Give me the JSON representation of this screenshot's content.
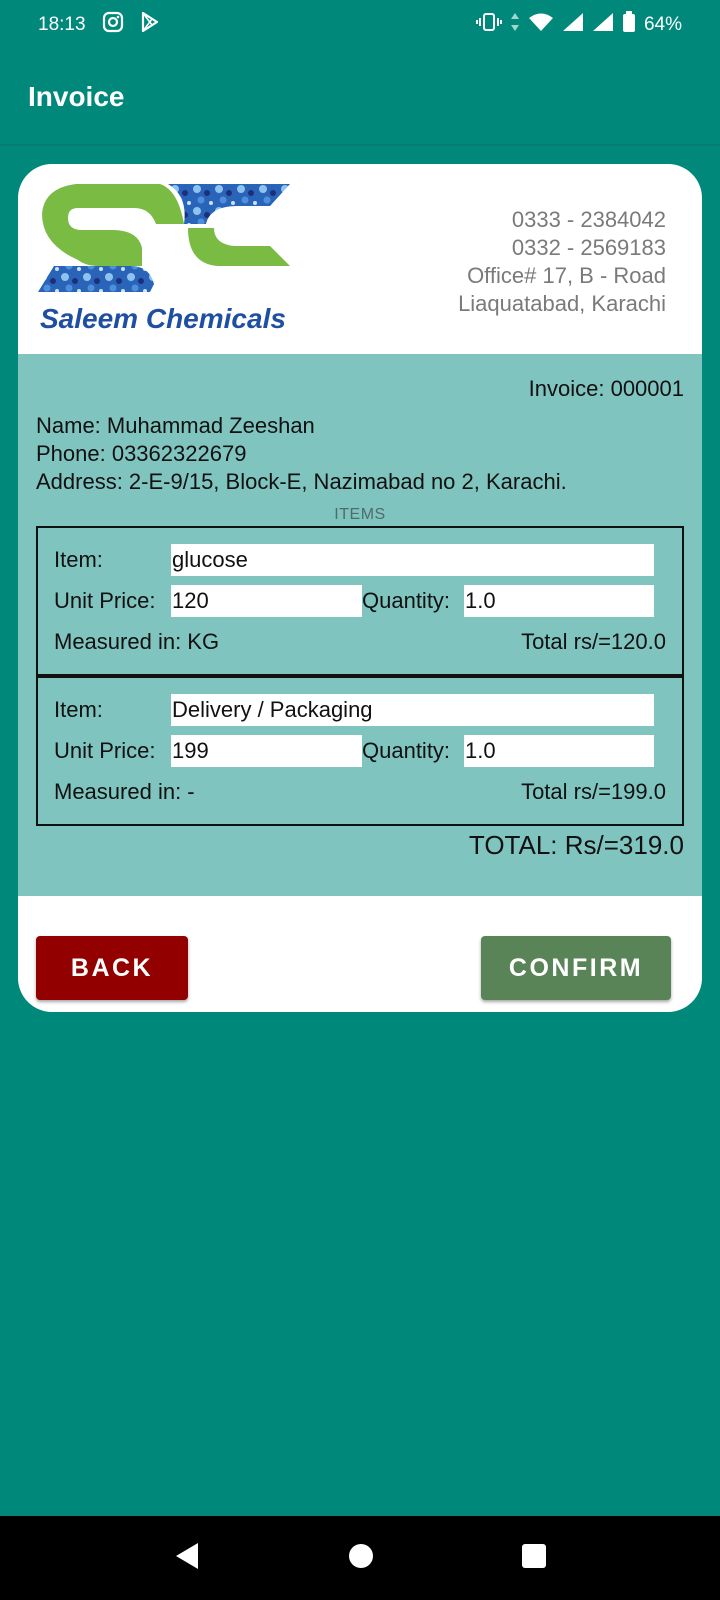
{
  "status_bar": {
    "time": "18:13",
    "battery": "64%"
  },
  "app_bar": {
    "title": "Invoice"
  },
  "header": {
    "logo_text": "Saleem Chemicals",
    "phone_1": "0333 - 2384042",
    "phone_2": "0332 - 2569183",
    "address_1": "Office# 17, B - Road",
    "address_2": "Liaquatabad, Karachi"
  },
  "invoice": {
    "number_label": "Invoice: 000001",
    "name": "Name: Muhammad Zeeshan",
    "phone": "Phone: 03362322679",
    "address": "Address: 2-E-9/15, Block-E, Nazimabad no 2, Karachi.",
    "items_heading": "ITEMS"
  },
  "labels": {
    "item": "Item:",
    "unit_price": "Unit Price:",
    "quantity": "Quantity:"
  },
  "items": [
    {
      "name": "glucose",
      "unit_price": "120",
      "quantity": "1.0",
      "measured": "Measured in: KG",
      "total": "Total rs/=120.0"
    },
    {
      "name": "Delivery / Packaging",
      "unit_price": "199",
      "quantity": "1.0",
      "measured": "Measured in: -",
      "total": "Total rs/=199.0"
    }
  ],
  "grand_total": "TOTAL: Rs/=319.0",
  "buttons": {
    "back": "BACK",
    "confirm": "CONFIRM"
  },
  "colors": {
    "background": "#00897b",
    "panel": "#80c4c0",
    "back_button": "#930000",
    "confirm_button": "#588458"
  }
}
